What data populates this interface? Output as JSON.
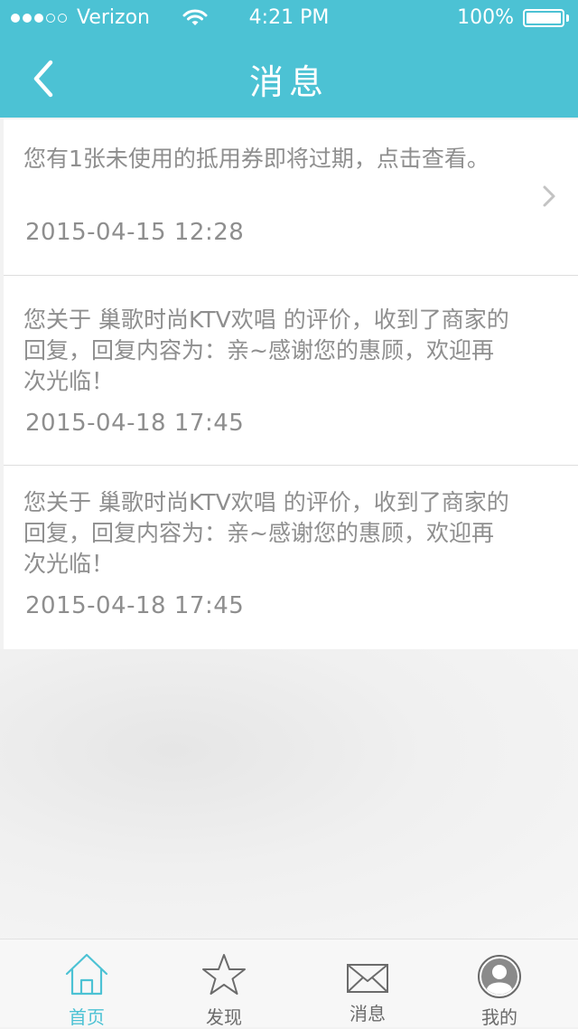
{
  "status_bar": {
    "carrier": "Verizon",
    "time": "4:21 PM",
    "battery": "100%",
    "signal_bars_filled": 3,
    "signal_bars_total": 5
  },
  "nav": {
    "title": "消息"
  },
  "messages": [
    {
      "text": "您有1张未使用的抵用券即将过期，点击查看。",
      "time": "2015-04-15 12:28"
    },
    {
      "text": "您关于 巢歌时尚KTV欢唱 的评价，收到了商家的回复，回复内容为：亲~感谢您的惠顾，欢迎再次光临！",
      "time": "2015-04-18 17:45"
    },
    {
      "text": "您关于 巢歌时尚KTV欢唱 的评价，收到了商家的回复，回复内容为：亲~感谢您的惠顾，欢迎再次光临！",
      "time": "2015-04-18 17:45"
    }
  ],
  "tabbar": {
    "items": [
      {
        "label": "首页",
        "icon": "home-icon",
        "active": true
      },
      {
        "label": "发现",
        "icon": "star-icon",
        "active": false
      },
      {
        "label": "消息",
        "icon": "envelope-icon",
        "active": false
      },
      {
        "label": "我的",
        "icon": "avatar-icon",
        "active": false
      }
    ]
  },
  "colors": {
    "accent": "#4cc2d4",
    "text_gray": "#8e8e8e",
    "tab_inactive": "#6b6b6b"
  }
}
